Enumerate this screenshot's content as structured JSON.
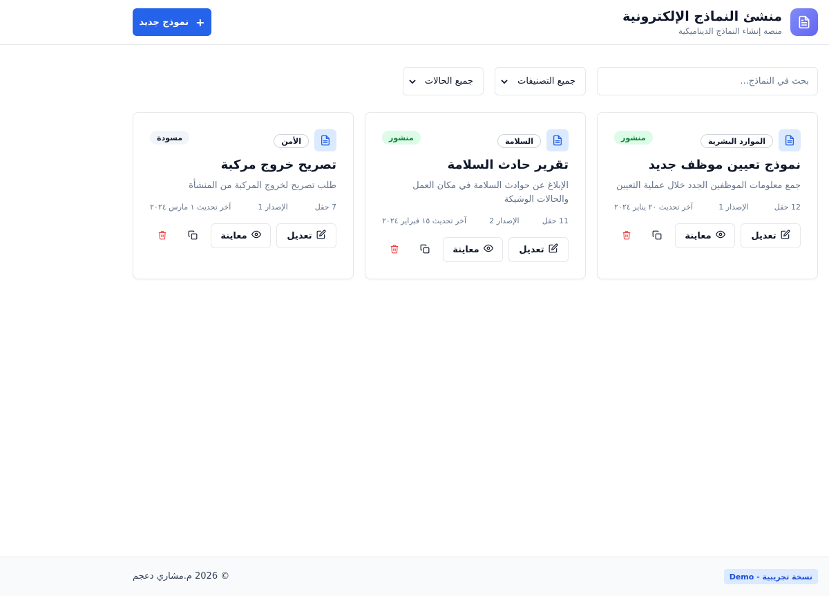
{
  "header": {
    "title": "منشئ النماذج الإلكترونية",
    "subtitle": "منصة إنشاء النماذج الديناميكية",
    "new_button": "نموذج جديد",
    "new_icon": "plus-icon",
    "logo_icon": "document-icon"
  },
  "filters": {
    "search_placeholder": "بحث في النماذج...",
    "category_select": "جميع التصنيفات",
    "status_select": "جميع الحالات"
  },
  "colors": {
    "primary": "#2563eb",
    "published_bg": "#dcfce7",
    "published_fg": "#15803d",
    "delete": "#ef4444"
  },
  "cards": [
    {
      "category": "الموارد البشرية",
      "status": "منشور",
      "title": "نموذج تعيين موظف جديد",
      "description": "جمع معلومات الموظفين الجدد خلال عملية التعيين",
      "fields": "12 حقل",
      "version": "الإصدار 1",
      "updated": "آخر تحديث ٢٠ يناير ٢٠٢٤",
      "edit_label": "تعديل",
      "preview_label": "معاينة"
    },
    {
      "category": "السلامة",
      "status": "منشور",
      "title": "تقرير حادث السلامة",
      "description": "الإبلاغ عن حوادث السلامة في مكان العمل والحالات الوشيكة",
      "fields": "11 حقل",
      "version": "الإصدار 2",
      "updated": "آخر تحديث ١٥ فبراير ٢٠٢٤",
      "edit_label": "تعديل",
      "preview_label": "معاينة"
    },
    {
      "category": "الأمن",
      "status": "مسودة",
      "title": "تصريح خروج مركبة",
      "description": "طلب تصريح لخروج المركبة من المنشأة",
      "fields": "7 حقل",
      "version": "الإصدار 1",
      "updated": "آخر تحديث ١ مارس ٢٠٢٤",
      "edit_label": "تعديل",
      "preview_label": "معاينة"
    }
  ],
  "footer": {
    "demo_badge": "نسخة تجريبية - Demo",
    "copyright": "© 2026 م.مشاري دعجم"
  }
}
